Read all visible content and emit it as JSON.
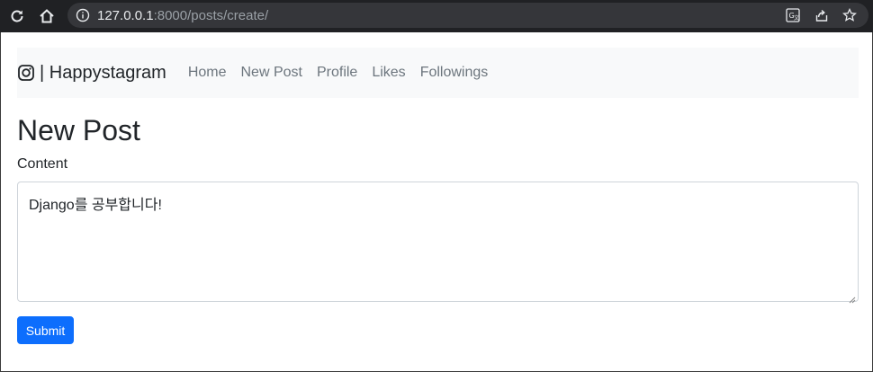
{
  "browser": {
    "url_host": "127.0.0.1",
    "url_rest": ":8000/posts/create/",
    "icons": [
      "reload-icon",
      "home-icon",
      "info-icon",
      "translate-icon",
      "share-icon",
      "bookmark-star-icon"
    ]
  },
  "navbar": {
    "brand": "| Happystagram",
    "brand_icon": "instagram-icon",
    "links": [
      {
        "label": "Home"
      },
      {
        "label": "New Post"
      },
      {
        "label": "Profile"
      },
      {
        "label": "Likes"
      },
      {
        "label": "Followings"
      }
    ]
  },
  "page": {
    "title": "New Post",
    "content_label": "Content",
    "content_value": "Django를 공부합니다!",
    "submit_label": "Submit"
  },
  "colors": {
    "primary": "#0d6efd",
    "navbar_bg": "#f8f9fa",
    "browser_bar": "#202124"
  }
}
